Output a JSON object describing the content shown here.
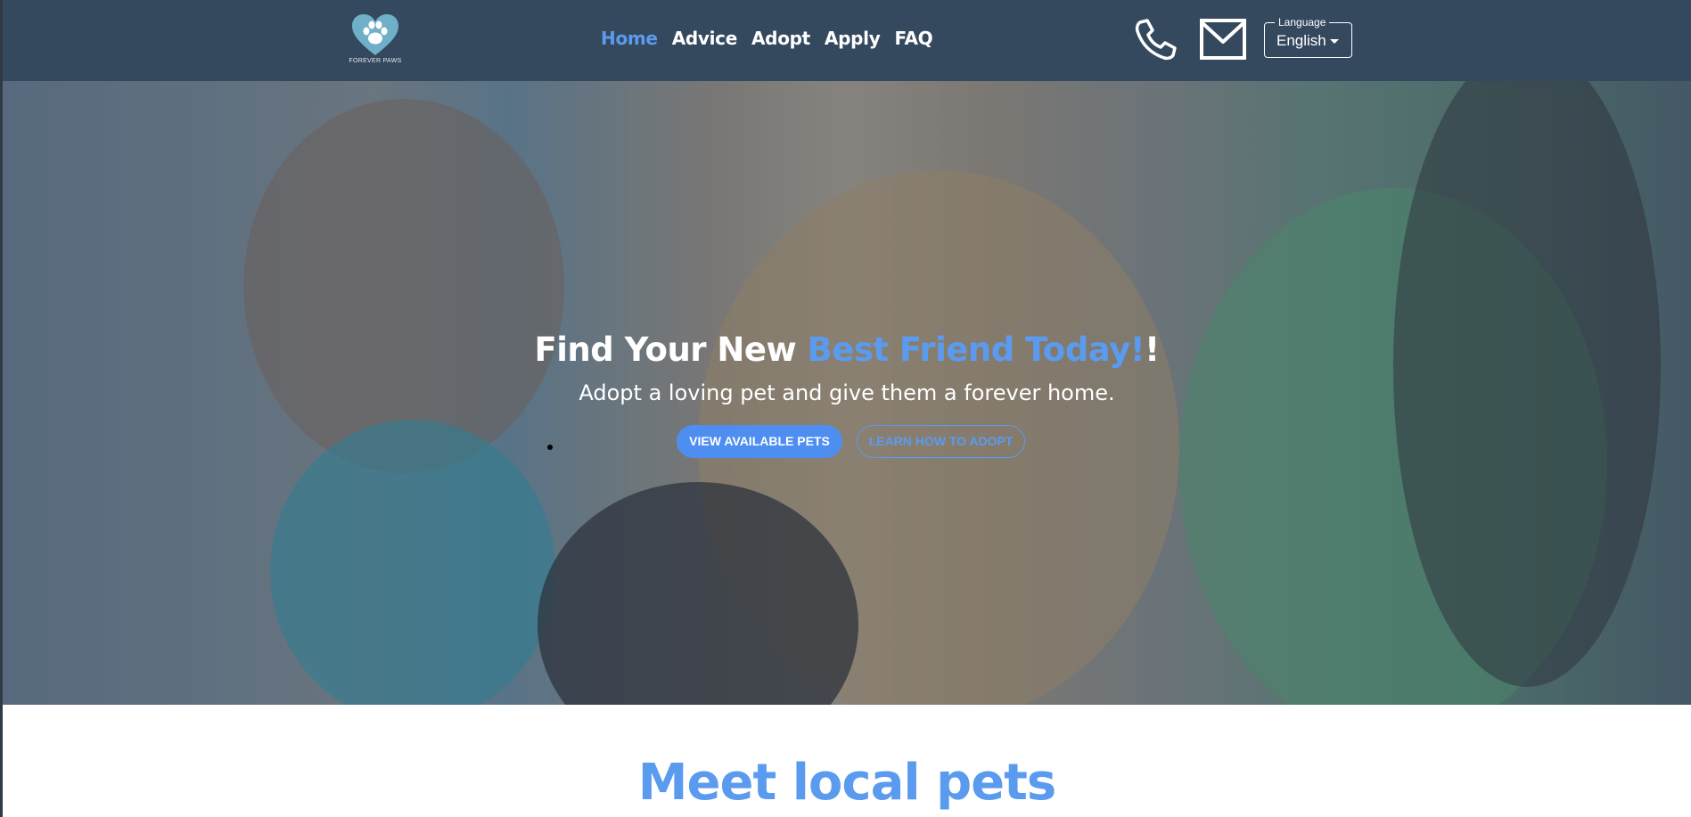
{
  "header": {
    "logo_text": "FOREVER PAWS",
    "nav": [
      {
        "label": "Home",
        "active": true
      },
      {
        "label": "Advice",
        "active": false
      },
      {
        "label": "Adopt",
        "active": false
      },
      {
        "label": "Apply",
        "active": false
      },
      {
        "label": "FAQ",
        "active": false
      }
    ],
    "phone_icon": "phone-icon",
    "mail_icon": "mail-icon",
    "language": {
      "legend": "Language",
      "value": "English"
    }
  },
  "hero": {
    "title_part1": "Find Your New ",
    "title_accent": "Best Friend Today!",
    "title_end": "!",
    "subtitle": "Adopt a loving pet and give them a forever home.",
    "primary_button": "VIEW AVAILABLE PETS",
    "secondary_button": "LEARN HOW TO ADOPT"
  },
  "section": {
    "title": "Meet local pets"
  },
  "colors": {
    "header_bg": "#35495e",
    "accent": "#5b9bef",
    "button_primary": "#4e8ef0",
    "logo_heart": "#6fb0c8"
  }
}
